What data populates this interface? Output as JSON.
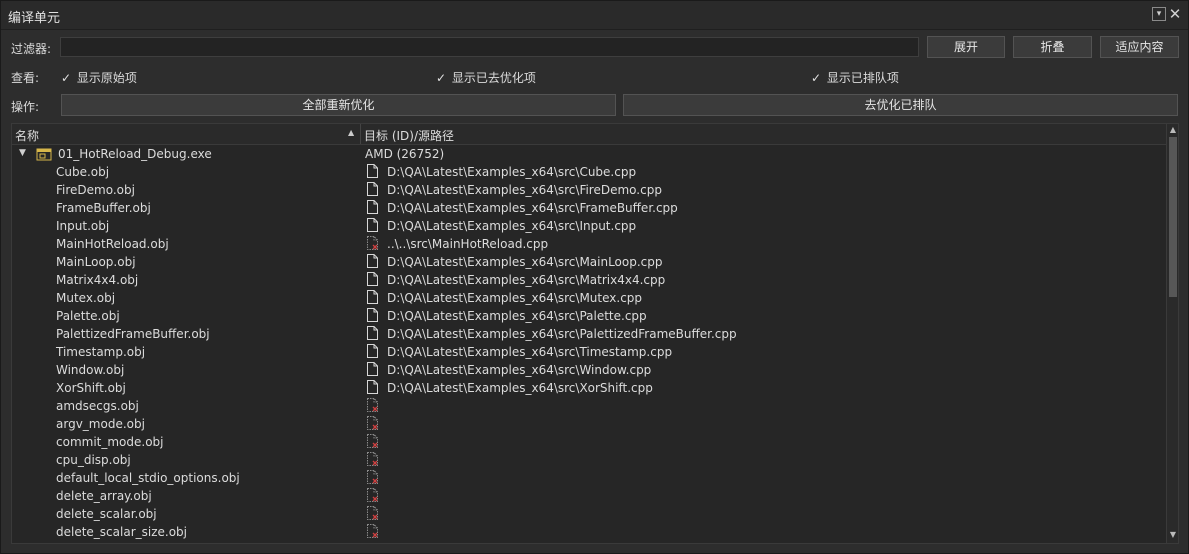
{
  "window": {
    "title": "编译单元"
  },
  "filter": {
    "label": "过滤器:",
    "value": "",
    "placeholder": ""
  },
  "buttons": {
    "expand": "展开",
    "collapse": "折叠",
    "fit": "适应内容",
    "reoptimize_all": "全部重新优化",
    "deoptimize_queued": "去优化已排队"
  },
  "view": {
    "label": "查看:",
    "show_original": {
      "label": "显示原始项",
      "checked": true
    },
    "show_deoptimized": {
      "label": "显示已去优化项",
      "checked": true
    },
    "show_queued": {
      "label": "显示已排队项",
      "checked": true
    }
  },
  "actions": {
    "label": "操作:"
  },
  "tree": {
    "columns": [
      "名称",
      "目标 (ID)/源路径"
    ],
    "root": {
      "name": "01_HotReload_Debug.exe",
      "target": "AMD (26752)"
    },
    "items": [
      {
        "name": "Cube.obj",
        "path": "D:\\QA\\Latest\\Examples_x64\\src\\Cube.cpp",
        "icon": "file-icon"
      },
      {
        "name": "FireDemo.obj",
        "path": "D:\\QA\\Latest\\Examples_x64\\src\\FireDemo.cpp",
        "icon": "file-icon"
      },
      {
        "name": "FrameBuffer.obj",
        "path": "D:\\QA\\Latest\\Examples_x64\\src\\FrameBuffer.cpp",
        "icon": "file-icon"
      },
      {
        "name": "Input.obj",
        "path": "D:\\QA\\Latest\\Examples_x64\\src\\Input.cpp",
        "icon": "file-icon"
      },
      {
        "name": "MainHotReload.obj",
        "path": "..\\..\\src\\MainHotReload.cpp",
        "icon": "missing-file-icon"
      },
      {
        "name": "MainLoop.obj",
        "path": "D:\\QA\\Latest\\Examples_x64\\src\\MainLoop.cpp",
        "icon": "file-icon"
      },
      {
        "name": "Matrix4x4.obj",
        "path": "D:\\QA\\Latest\\Examples_x64\\src\\Matrix4x4.cpp",
        "icon": "file-icon"
      },
      {
        "name": "Mutex.obj",
        "path": "D:\\QA\\Latest\\Examples_x64\\src\\Mutex.cpp",
        "icon": "file-icon"
      },
      {
        "name": "Palette.obj",
        "path": "D:\\QA\\Latest\\Examples_x64\\src\\Palette.cpp",
        "icon": "file-icon"
      },
      {
        "name": "PalettizedFrameBuffer.obj",
        "path": "D:\\QA\\Latest\\Examples_x64\\src\\PalettizedFrameBuffer.cpp",
        "icon": "file-icon"
      },
      {
        "name": "Timestamp.obj",
        "path": "D:\\QA\\Latest\\Examples_x64\\src\\Timestamp.cpp",
        "icon": "file-icon"
      },
      {
        "name": "Window.obj",
        "path": "D:\\QA\\Latest\\Examples_x64\\src\\Window.cpp",
        "icon": "file-icon"
      },
      {
        "name": "XorShift.obj",
        "path": "D:\\QA\\Latest\\Examples_x64\\src\\XorShift.cpp",
        "icon": "file-icon"
      },
      {
        "name": "amdsecgs.obj",
        "path": "",
        "icon": "missing-file-icon"
      },
      {
        "name": "argv_mode.obj",
        "path": "",
        "icon": "missing-file-icon"
      },
      {
        "name": "commit_mode.obj",
        "path": "",
        "icon": "missing-file-icon"
      },
      {
        "name": "cpu_disp.obj",
        "path": "",
        "icon": "missing-file-icon"
      },
      {
        "name": "default_local_stdio_options.obj",
        "path": "",
        "icon": "missing-file-icon"
      },
      {
        "name": "delete_array.obj",
        "path": "",
        "icon": "missing-file-icon"
      },
      {
        "name": "delete_scalar.obj",
        "path": "",
        "icon": "missing-file-icon"
      },
      {
        "name": "delete_scalar_size.obj",
        "path": "",
        "icon": "missing-file-icon"
      }
    ]
  },
  "colors": {
    "background": "#2d2d2d",
    "missing_mark": "#d04040"
  }
}
